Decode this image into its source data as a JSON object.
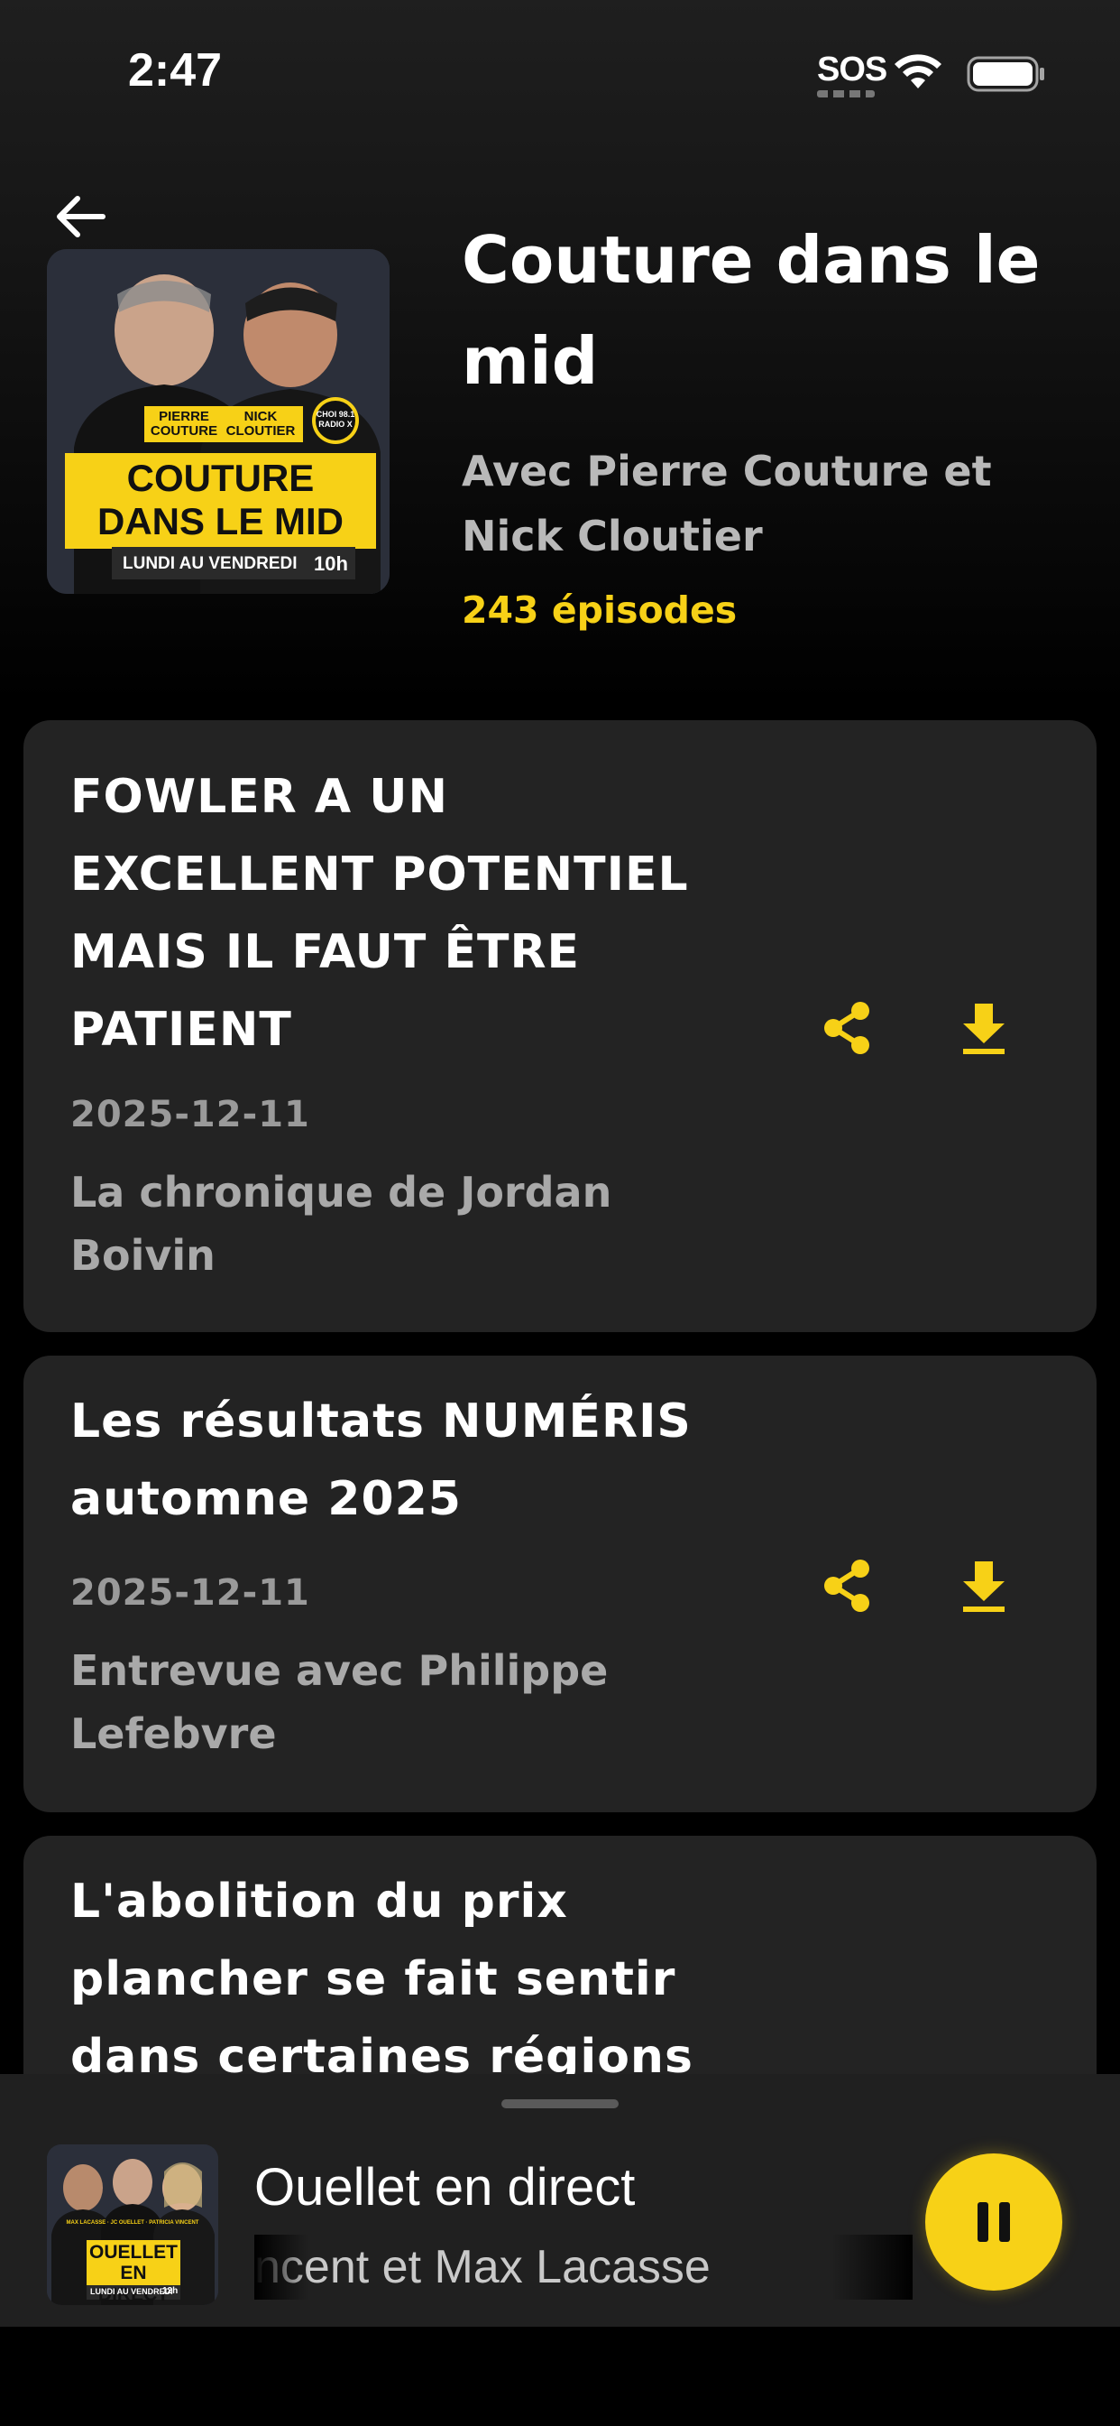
{
  "status_bar": {
    "time": "2:47",
    "sos": "SOS"
  },
  "colors": {
    "accent": "#f7d117",
    "card_bg": "#232323",
    "background": "#000000"
  },
  "header": {
    "back_icon": "arrow-left-icon",
    "title": "Couture dans le mid",
    "hosts": "Avec Pierre Couture et Nick Cloutier",
    "episode_count": "243 épisodes",
    "cover": {
      "host1": "PIERRE COUTURE",
      "host2": "NICK CLOUTIER",
      "logo": "CHOI 98.1 RADIO X",
      "show_line1": "COUTURE",
      "show_line2": "DANS LE MID",
      "schedule": "LUNDI AU VENDREDI",
      "time": "10h"
    }
  },
  "episodes": [
    {
      "title": "FOWLER A UN EXCELLENT POTENTIEL MAIS IL FAUT ÊTRE PATIENT",
      "date": "2025-12-11",
      "description": "La chronique de Jordan Boivin",
      "share_icon": "share-icon",
      "download_icon": "download-icon"
    },
    {
      "title": "Les résultats NUMÉRIS automne 2025",
      "date": "2025-12-11",
      "description": "Entrevue avec Philippe Lefebvre",
      "share_icon": "share-icon",
      "download_icon": "download-icon"
    },
    {
      "title": "L'abolition du prix plancher se fait sentir dans certaines régions"
    }
  ],
  "mini_player": {
    "title": "Ouellet en direct",
    "subtitle": "ncent et Max Lacasse",
    "pause_icon": "pause-icon",
    "cover": {
      "names": "MAX LACASSE · JC OUELLET · PATRICIA VINCENT",
      "show_line1": "OUELLET",
      "show_line2": "EN DIRECT",
      "schedule": "LUNDI AU VENDREDI",
      "time": "12h"
    }
  }
}
